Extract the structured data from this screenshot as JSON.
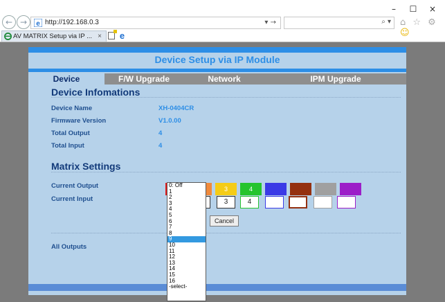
{
  "browser": {
    "url": "http://192.168.0.3",
    "tab_title": "AV MATRIX Setup via IP ...",
    "tab_close": "×",
    "minimize": "–",
    "maximize": "☐",
    "close": "×",
    "back_glyph": "←",
    "forward_glyph": "→",
    "addr_tools": "▾ →",
    "search_tools": "⌕ ▾",
    "right_icons": "⌂ ☆ ⚙"
  },
  "page": {
    "title": "Device Setup via IP Module",
    "tabs": [
      "Device",
      "F/W Upgrade",
      "Network",
      "IPM Upgrade"
    ],
    "device_section": "Device Infomations",
    "device_info": [
      {
        "label": "Device Name",
        "value": "XH-0404CR"
      },
      {
        "label": "Firmware Version",
        "value": "V1.0.00"
      },
      {
        "label": "Total Output",
        "value": "4"
      },
      {
        "label": "Total Input",
        "value": "4"
      }
    ],
    "matrix_section": "Matrix Settings",
    "current_output_label": "Current Output",
    "current_input_label": "Current Input",
    "outputs": [
      {
        "label": "1",
        "color": "#e21b1b"
      },
      {
        "label": "2",
        "color": "#f08a3c"
      },
      {
        "label": "3",
        "color": "#f5cc17"
      },
      {
        "label": "4",
        "color": "#25c42e"
      },
      {
        "label": "",
        "color": "#3a3ae6"
      },
      {
        "label": "",
        "color": "#943010"
      },
      {
        "label": "",
        "color": "#a0a0a0"
      },
      {
        "label": "",
        "color": "#9c1ec8"
      }
    ],
    "inputs": [
      "",
      "",
      "3",
      "4",
      "",
      "",
      "",
      ""
    ],
    "cancel_label": "Cancel",
    "all_outputs_label": "All Outputs"
  },
  "dropdown": {
    "options": [
      "0: Off",
      "1",
      "2",
      "3",
      "4",
      "5",
      "6",
      "7",
      "8",
      "9",
      "10",
      "11",
      "12",
      "13",
      "14",
      "15",
      "16",
      "-select-"
    ],
    "highlighted": "9"
  }
}
